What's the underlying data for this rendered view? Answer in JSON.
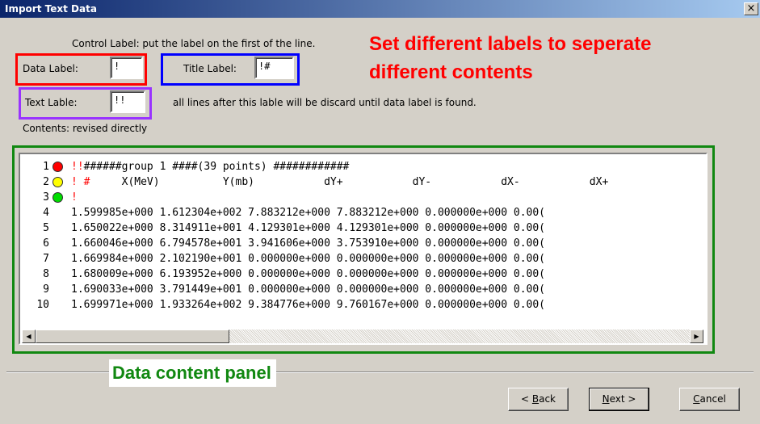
{
  "window": {
    "title": "Import Text Data",
    "close_glyph": "×"
  },
  "controls": {
    "control_label_text": "Control Label: put the label on the first of the line.",
    "data_label": {
      "label": "Data Label:",
      "value": "!"
    },
    "title_label": {
      "label": "Title Label:",
      "value": "!#"
    },
    "text_label": {
      "label": "Text Lable:",
      "value": "!!"
    },
    "discard_text": "all lines after this lable will be discard until data label is found.",
    "contents_text": "Contents: revised directly"
  },
  "annotations": {
    "labels_note_line1": "Set different labels to seperate",
    "labels_note_line2": "different contents",
    "panel_note": "Data content panel"
  },
  "colors": {
    "annotation_red": "#ff0000",
    "annotation_green": "#118811",
    "box_data_label": "#ff0000",
    "box_title_label": "#0000ff",
    "box_text_label": "#9933ff",
    "marker_text": "#ff0000",
    "marker_title": "#ffff00",
    "marker_data": "#00dd00"
  },
  "content": {
    "lines": [
      {
        "n": "1",
        "marker": "red",
        "prefix": "!!",
        "text": "######group 1 ####(39 points) ############"
      },
      {
        "n": "2",
        "marker": "yellow",
        "prefix": "! #",
        "text": "     X(MeV)          Y(mb)           dY+           dY-           dX-           dX+"
      },
      {
        "n": "3",
        "marker": "green",
        "prefix": "!",
        "text": ""
      },
      {
        "n": "4",
        "marker": "",
        "prefix": "",
        "text": "1.599985e+000 1.612304e+002 7.883212e+000 7.883212e+000 0.000000e+000 0.00("
      },
      {
        "n": "5",
        "marker": "",
        "prefix": "",
        "text": "1.650022e+000 8.314911e+001 4.129301e+000 4.129301e+000 0.000000e+000 0.00("
      },
      {
        "n": "6",
        "marker": "",
        "prefix": "",
        "text": "1.660046e+000 6.794578e+001 3.941606e+000 3.753910e+000 0.000000e+000 0.00("
      },
      {
        "n": "7",
        "marker": "",
        "prefix": "",
        "text": "1.669984e+000 2.102190e+001 0.000000e+000 0.000000e+000 0.000000e+000 0.00("
      },
      {
        "n": "8",
        "marker": "",
        "prefix": "",
        "text": "1.680009e+000 6.193952e+000 0.000000e+000 0.000000e+000 0.000000e+000 0.00("
      },
      {
        "n": "9",
        "marker": "",
        "prefix": "",
        "text": "1.690033e+000 3.791449e+001 0.000000e+000 0.000000e+000 0.000000e+000 0.00("
      },
      {
        "n": "10",
        "marker": "",
        "prefix": "",
        "text": "1.699971e+000 1.933264e+002 9.384776e+000 9.760167e+000 0.000000e+000 0.00("
      }
    ]
  },
  "buttons": {
    "back": {
      "underlined": "B",
      "rest": "ack",
      "prefix": "< "
    },
    "next": {
      "underlined": "N",
      "rest": "ext >"
    },
    "cancel": {
      "underlined": "C",
      "rest": "ancel"
    }
  },
  "icons": {
    "scroll_up": "up-arrow-icon",
    "scroll_down": "down-arrow-icon",
    "scroll_left": "left-arrow-icon",
    "scroll_right": "right-arrow-icon",
    "close": "close-icon"
  }
}
